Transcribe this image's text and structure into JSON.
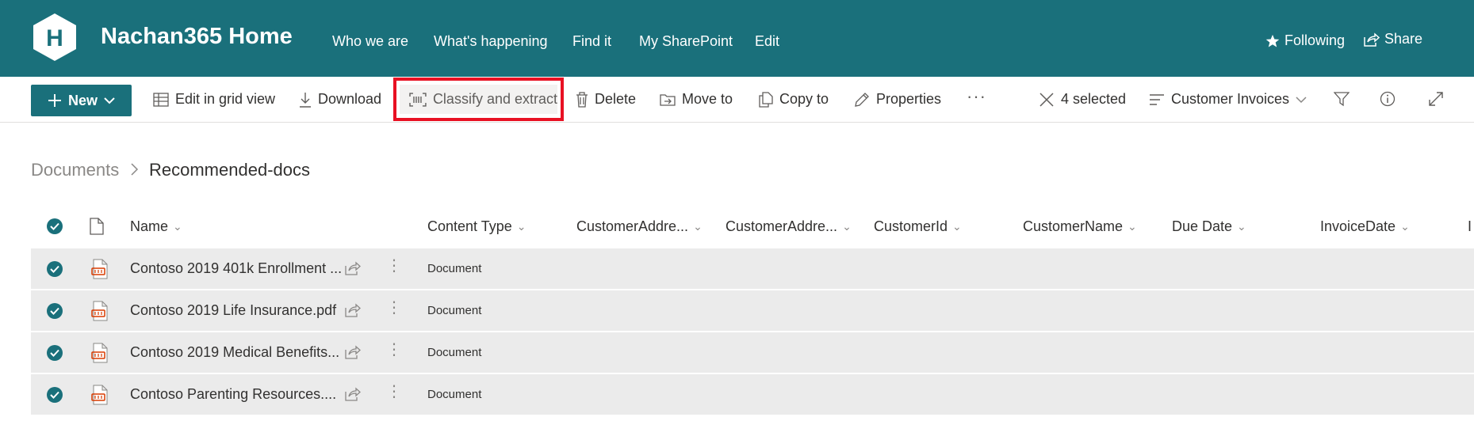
{
  "header": {
    "logo_letter": "H",
    "site_title": "Nachan365 Home",
    "nav": [
      "Who we are",
      "What's happening",
      "Find it",
      "My SharePoint",
      "Edit"
    ],
    "following_label": "Following",
    "share_label": "Share"
  },
  "commandbar": {
    "new_label": "New",
    "edit_grid_label": "Edit in grid view",
    "download_label": "Download",
    "classify_label": "Classify and extract",
    "delete_label": "Delete",
    "move_label": "Move to",
    "copy_label": "Copy to",
    "properties_label": "Properties",
    "more_label": "···",
    "selected_label": "4 selected",
    "view_label": "Customer Invoices"
  },
  "breadcrumb": {
    "root": "Documents",
    "separator": ">",
    "current": "Recommended-docs"
  },
  "list": {
    "columns": [
      "Name",
      "Content Type",
      "CustomerAddre...",
      "CustomerAddre...",
      "CustomerId",
      "CustomerName",
      "Due Date",
      "InvoiceDate",
      "I"
    ],
    "rows": [
      {
        "name": "Contoso 2019 401k Enrollment ...",
        "content_type": "Document"
      },
      {
        "name": "Contoso 2019 Life Insurance.pdf",
        "content_type": "Document"
      },
      {
        "name": "Contoso 2019 Medical Benefits...",
        "content_type": "Document"
      },
      {
        "name": "Contoso Parenting Resources....",
        "content_type": "Document"
      }
    ]
  },
  "colors": {
    "brand": "#1a707b",
    "highlight": "#e81123",
    "selected_row": "#ebebeb",
    "pdf_icon": "#d83b01"
  }
}
